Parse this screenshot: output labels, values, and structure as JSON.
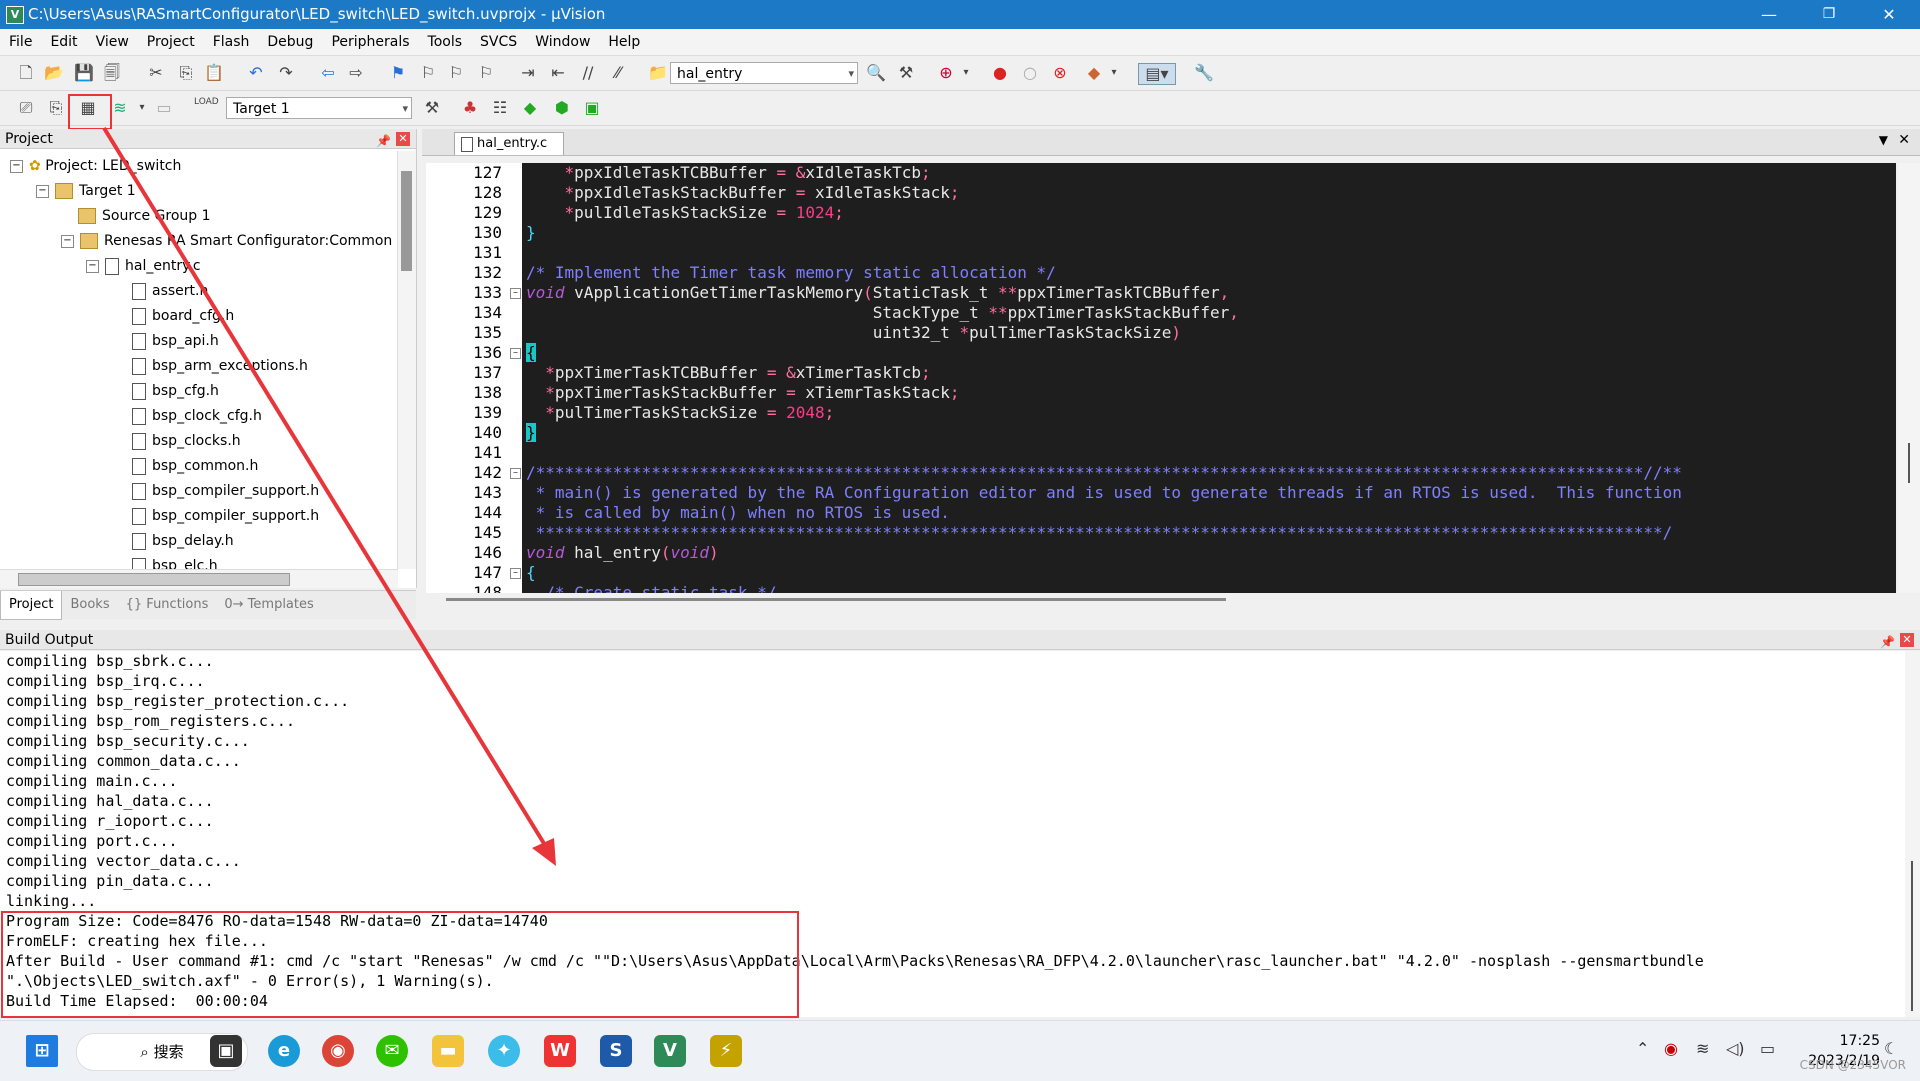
{
  "window": {
    "title": "C:\\Users\\Asus\\RASmartConfigurator\\LED_switch\\LED_switch.uvprojx - µVision",
    "minimize": "—",
    "restore": "❐",
    "close": "✕"
  },
  "menu": [
    "File",
    "Edit",
    "View",
    "Project",
    "Flash",
    "Debug",
    "Peripherals",
    "Tools",
    "SVCS",
    "Window",
    "Help"
  ],
  "toolbar": {
    "function_combo": "hal_entry",
    "target_combo": "Target 1"
  },
  "project_panel": {
    "title": "Project",
    "tree": [
      {
        "label": "Project: LED_switch",
        "kind": "project",
        "level": 0
      },
      {
        "label": "Target 1",
        "kind": "target",
        "level": 1
      },
      {
        "label": "Source Group 1",
        "kind": "folder",
        "level": 2
      },
      {
        "label": "Renesas RA Smart Configurator:Common S...",
        "kind": "folder",
        "level": 2
      },
      {
        "label": "hal_entry.c",
        "kind": "file",
        "level": 3
      },
      {
        "label": "assert.h",
        "kind": "file",
        "level": 4
      },
      {
        "label": "board_cfg.h",
        "kind": "file",
        "level": 4
      },
      {
        "label": "bsp_api.h",
        "kind": "file",
        "level": 4
      },
      {
        "label": "bsp_arm_exceptions.h",
        "kind": "file",
        "level": 4
      },
      {
        "label": "bsp_cfg.h",
        "kind": "file",
        "level": 4
      },
      {
        "label": "bsp_clock_cfg.h",
        "kind": "file",
        "level": 4
      },
      {
        "label": "bsp_clocks.h",
        "kind": "file",
        "level": 4
      },
      {
        "label": "bsp_common.h",
        "kind": "file",
        "level": 4
      },
      {
        "label": "bsp_compiler_support.h",
        "kind": "file",
        "level": 4
      },
      {
        "label": "bsp_compiler_support.h",
        "kind": "file",
        "level": 4
      },
      {
        "label": "bsp_delay.h",
        "kind": "file",
        "level": 4
      },
      {
        "label": "bsp_elc.h",
        "kind": "file",
        "level": 4
      }
    ],
    "tabs": [
      "Project",
      "Books",
      "{} Functions",
      "0→ Templates"
    ]
  },
  "editor": {
    "tab": "hal_entry.c",
    "lines": [
      {
        "n": "127",
        "fold": "",
        "html": "    <span class='c-op'>*</span><span class='c-ident'>ppxIdleTaskTCBBuffer</span> <span class='c-op'>=</span> <span class='c-op'>&amp;</span><span class='c-ident'>xIdleTaskTcb</span><span class='c-op'>;</span>"
      },
      {
        "n": "128",
        "fold": "",
        "html": "    <span class='c-op'>*</span><span class='c-ident'>ppxIdleTaskStackBuffer</span> <span class='c-op'>=</span> <span class='c-ident'>xIdleTaskStack</span><span class='c-op'>;</span>"
      },
      {
        "n": "129",
        "fold": "",
        "html": "    <span class='c-op'>*</span><span class='c-ident'>pulIdleTaskStackSize</span> <span class='c-op'>=</span> <span class='c-num'>1024</span><span class='c-op'>;</span>"
      },
      {
        "n": "130",
        "fold": "",
        "html": "<span class='c-brace'>}</span>"
      },
      {
        "n": "131",
        "fold": "",
        "html": ""
      },
      {
        "n": "132",
        "fold": "",
        "html": "<span class='c-com'>/* Implement the Timer task memory static allocation */</span>"
      },
      {
        "n": "133",
        "fold": "−",
        "html": "<span class='c-kw'>void</span> <span class='c-ident'>vApplicationGetTimerTaskMemory</span><span class='c-op'>(</span><span class='c-ident'>StaticTask_t</span> <span class='c-op'>**</span><span class='c-ident'>ppxTimerTaskTCBBuffer</span><span class='c-op'>,</span>"
      },
      {
        "n": "134",
        "fold": "",
        "html": "                                    <span class='c-ident'>StackType_t</span> <span class='c-op'>**</span><span class='c-ident'>ppxTimerTaskStackBuffer</span><span class='c-op'>,</span>"
      },
      {
        "n": "135",
        "fold": "",
        "html": "                                    <span class='c-ident'>uint32_t</span> <span class='c-op'>*</span><span class='c-ident'>pulTimerTaskStackSize</span><span class='c-op'>)</span>"
      },
      {
        "n": "136",
        "fold": "−",
        "html": "<span class='bracebox'>{</span>"
      },
      {
        "n": "137",
        "fold": "",
        "html": "  <span class='c-op'>*</span><span class='c-ident'>ppxTimerTaskTCBBuffer</span> <span class='c-op'>=</span> <span class='c-op'>&amp;</span><span class='c-ident'>xTimerTaskTcb</span><span class='c-op'>;</span>"
      },
      {
        "n": "138",
        "fold": "",
        "html": "  <span class='c-op'>*</span><span class='c-ident'>ppxTimerTaskStackBuffer</span> <span class='c-op'>=</span> <span class='c-ident'>xTiemrTaskStack</span><span class='c-op'>;</span>"
      },
      {
        "n": "139",
        "fold": "",
        "html": "  <span class='c-op'>*</span><span class='c-ident'>pulTimerTaskStackSize</span> <span class='c-op'>=</span> <span class='c-num'>2048</span><span class='c-op'>;</span>"
      },
      {
        "n": "140",
        "fold": "",
        "html": "<span class='bracebox'>}</span>"
      },
      {
        "n": "141",
        "fold": "",
        "html": ""
      },
      {
        "n": "142",
        "fold": "−",
        "html": "<span class='c-com'>/*******************************************************************************************************************//**</span>"
      },
      {
        "n": "143",
        "fold": "",
        "html": "<span class='c-com'> * main() is generated by the RA Configuration editor and is used to generate threads if an RTOS is used.  This function</span>"
      },
      {
        "n": "144",
        "fold": "",
        "html": "<span class='c-com'> * is called by main() when no RTOS is used.</span>"
      },
      {
        "n": "145",
        "fold": "",
        "html": "<span class='c-com'> *********************************************************************************************************************/</span>"
      },
      {
        "n": "146",
        "fold": "",
        "html": "<span class='c-kw'>void</span> <span class='c-ident'>hal_entry</span><span class='c-op'>(</span><span class='c-kw'>void</span><span class='c-op'>)</span>"
      },
      {
        "n": "147",
        "fold": "−",
        "html": "<span class='c-brace'>{</span>"
      },
      {
        "n": "148",
        "fold": "",
        "html": "  <span class='c-com'>/* Create static task */</span>"
      }
    ]
  },
  "build_output": {
    "title": "Build Output",
    "lines": [
      "compiling bsp_sbrk.c...",
      "compiling bsp_irq.c...",
      "compiling bsp_register_protection.c...",
      "compiling bsp_rom_registers.c...",
      "compiling bsp_security.c...",
      "compiling common_data.c...",
      "compiling main.c...",
      "compiling hal_data.c...",
      "compiling r_ioport.c...",
      "compiling port.c...",
      "compiling vector_data.c...",
      "compiling pin_data.c...",
      "linking...",
      "Program Size: Code=8476 RO-data=1548 RW-data=0 ZI-data=14740",
      "FromELF: creating hex file...",
      "After Build - User command #1: cmd /c \"start \"Renesas\" /w cmd /c \"\"D:\\Users\\Asus\\AppData\\Local\\Arm\\Packs\\Renesas\\RA_DFP\\4.2.0\\launcher\\rasc_launcher.bat\" \"4.2.0\" -nosplash --gensmartbundle",
      "\".\\Objects\\LED_switch.axf\" - 0 Error(s), 1 Warning(s).",
      "Build Time Elapsed:  00:00:04"
    ]
  },
  "taskbar": {
    "search_label": "搜索",
    "time": "17:25",
    "date": "2023/2/19"
  },
  "watermark": "CSDN @2345VOR",
  "colors": {
    "titlebar": "#1b79c6",
    "annotation_red": "#e8353a",
    "editor_bg": "#1e1e1e"
  }
}
